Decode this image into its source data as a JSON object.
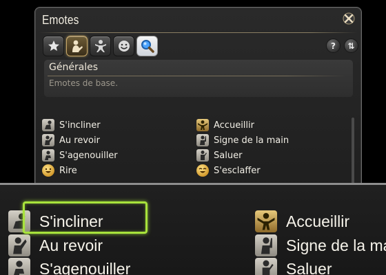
{
  "window": {
    "title": "Emotes",
    "toolbar": {
      "tabs": [
        {
          "icon": "star-icon",
          "active": false
        },
        {
          "icon": "person-gesture-icon",
          "active": true
        },
        {
          "icon": "dancing-figure-icon",
          "active": false
        },
        {
          "icon": "smiley-face-icon",
          "active": false
        },
        {
          "icon": "magnifier-icon",
          "active": false
        }
      ],
      "help_label": "?",
      "sort_label": "⇅"
    },
    "category": {
      "title": "Générales",
      "description": "Emotes de base."
    },
    "emotes_left": [
      {
        "label": "S'incliner",
        "icon": "bow-icon"
      },
      {
        "label": "Au revoir",
        "icon": "wave-goodbye-icon"
      },
      {
        "label": "S'agenouiller",
        "icon": "kneel-icon"
      },
      {
        "label": "Rire",
        "icon": "laugh-icon"
      }
    ],
    "emotes_right": [
      {
        "label": "Accueillir",
        "icon": "welcome-icon"
      },
      {
        "label": "Signe de la main",
        "icon": "hand-wave-icon"
      },
      {
        "label": "Saluer",
        "icon": "salute-icon"
      },
      {
        "label": "S'esclaffer",
        "icon": "chuckle-icon"
      }
    ]
  },
  "zoom": {
    "left": [
      {
        "label": "S'incliner",
        "icon": "bow-icon"
      },
      {
        "label": "Au revoir",
        "icon": "wave-goodbye-icon"
      },
      {
        "label": "S'agenouiller",
        "icon": "kneel-icon"
      }
    ],
    "right": [
      {
        "label": "Accueillir",
        "icon": "welcome-icon"
      },
      {
        "label": "Signe de la main",
        "icon": "hand-wave-icon"
      },
      {
        "label": "Saluer",
        "icon": "salute-icon"
      }
    ]
  },
  "colors": {
    "highlight": "#a8e33c",
    "active_tab_border": "#c9a96a",
    "text": "#f2efe6"
  }
}
